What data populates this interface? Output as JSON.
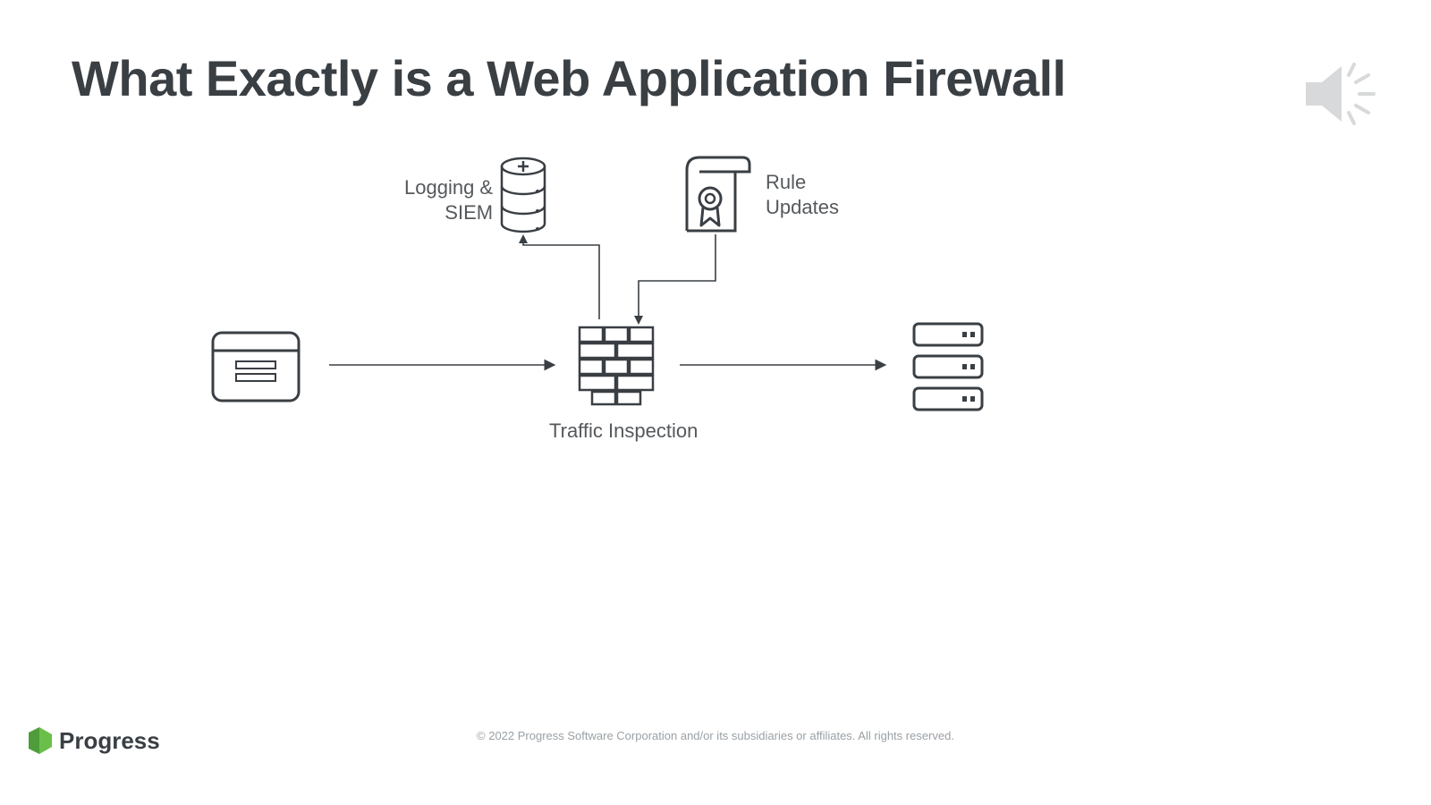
{
  "title": "What Exactly is a Web Application Firewall",
  "labels": {
    "siem_l1": "Logging &",
    "siem_l2": "SIEM",
    "rules_l1": "Rule",
    "rules_l2": "Updates",
    "traffic": "Traffic Inspection"
  },
  "footer": "© 2022 Progress Software Corporation and/or its subsidiaries or affiliates. All rights reserved.",
  "logo": "Progress"
}
